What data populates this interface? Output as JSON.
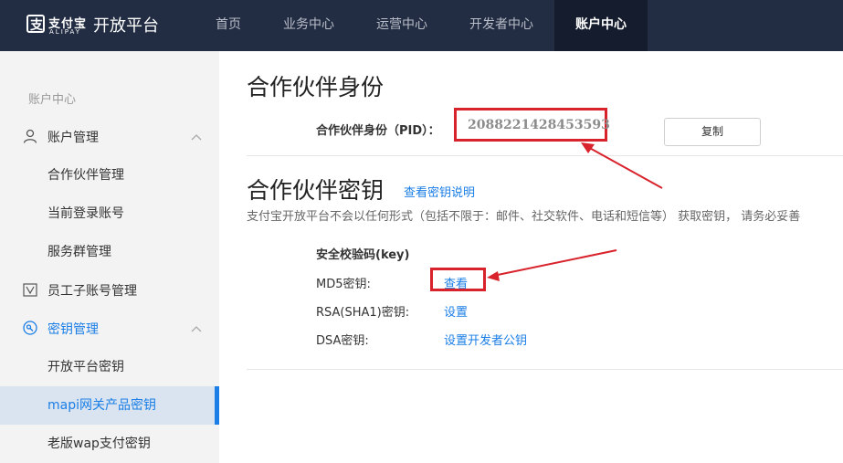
{
  "header": {
    "logo_cn": "支付宝",
    "logo_en": "ALIPAY",
    "title": "开放平台",
    "nav": [
      {
        "label": "首页"
      },
      {
        "label": "业务中心"
      },
      {
        "label": "运营中心"
      },
      {
        "label": "开发者中心"
      },
      {
        "label": "账户中心",
        "active": true
      }
    ]
  },
  "sidebar": {
    "section_title": "账户中心",
    "groups": {
      "account_mgmt": "账户管理",
      "employee": "员工子账号管理",
      "key_mgmt": "密钥管理"
    },
    "items": {
      "partner_mgmt": "合作伙伴管理",
      "current_login": "当前登录账号",
      "service_group": "服务群管理",
      "open_platform_key": "开放平台密钥",
      "mapi_key": "mapi网关产品密钥",
      "wap_key": "老版wap支付密钥"
    }
  },
  "main": {
    "partner_identity_title": "合作伙伴身份",
    "pid_label": "合作伙伴身份（PID）：",
    "pid_value": "2088221428453593",
    "copy_label": "复制",
    "partner_key_title": "合作伙伴密钥",
    "key_doc_link": "查看密钥说明",
    "notice": "支付宝开放平台不会以任何形式（包括不限于：邮件、社交软件、电话和短信等） 获取密钥， 请务必妥善",
    "security_title": "安全校验码(key)",
    "md5_label": "MD5密钥:",
    "md5_action": "查看",
    "rsa_label": "RSA(SHA1)密钥:",
    "rsa_action": "设置",
    "dsa_label": "DSA密钥:",
    "dsa_action": "设置开发者公钥"
  },
  "colors": {
    "topbar": "#222d44",
    "accent": "#1a7ee6",
    "highlight": "#d9232c"
  }
}
